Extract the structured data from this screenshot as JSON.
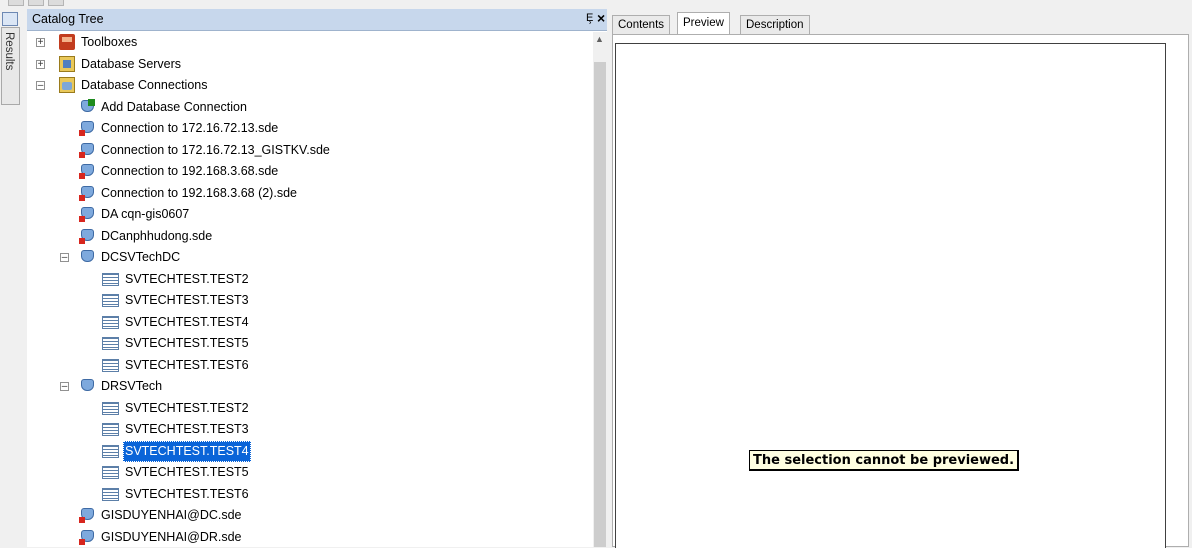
{
  "results_tab": "Results",
  "catalog": {
    "title": "Catalog Tree",
    "pin_glyph": "Ȩ",
    "close_glyph": "×",
    "items": [
      {
        "label": "Toolboxes",
        "indent": 0,
        "expander": "+",
        "icon": "toolbox-icon"
      },
      {
        "label": "Database Servers",
        "indent": 0,
        "expander": "+",
        "icon": "database-servers-icon"
      },
      {
        "label": "Database Connections",
        "indent": 0,
        "expander": "−",
        "icon": "database-connections-icon"
      },
      {
        "label": "Add Database Connection",
        "indent": 1,
        "icon": "add-connection-icon"
      },
      {
        "label": "Connection to 172.16.72.13.sde",
        "indent": 1,
        "icon": "sde-disconnected-icon"
      },
      {
        "label": "Connection to 172.16.72.13_GISTKV.sde",
        "indent": 1,
        "icon": "sde-disconnected-icon"
      },
      {
        "label": "Connection to 192.168.3.68.sde",
        "indent": 1,
        "icon": "sde-disconnected-icon"
      },
      {
        "label": "Connection to 192.168.3.68 (2).sde",
        "indent": 1,
        "icon": "sde-disconnected-icon"
      },
      {
        "label": "DA cqn-gis0607",
        "indent": 1,
        "icon": "sde-disconnected-icon"
      },
      {
        "label": "DCanphhudong.sde",
        "indent": 1,
        "icon": "sde-disconnected-icon"
      },
      {
        "label": "DCSVTechDC",
        "indent": 1,
        "expander": "−",
        "icon": "sde-connected-icon"
      },
      {
        "label": "SVTECHTEST.TEST2",
        "indent": 2,
        "icon": "table-icon"
      },
      {
        "label": "SVTECHTEST.TEST3",
        "indent": 2,
        "icon": "table-icon"
      },
      {
        "label": "SVTECHTEST.TEST4",
        "indent": 2,
        "icon": "table-icon"
      },
      {
        "label": "SVTECHTEST.TEST5",
        "indent": 2,
        "icon": "table-icon"
      },
      {
        "label": "SVTECHTEST.TEST6",
        "indent": 2,
        "icon": "table-icon"
      },
      {
        "label": "DRSVTech",
        "indent": 1,
        "expander": "−",
        "icon": "sde-connected-icon"
      },
      {
        "label": "SVTECHTEST.TEST2",
        "indent": 2,
        "icon": "table-icon"
      },
      {
        "label": "SVTECHTEST.TEST3",
        "indent": 2,
        "icon": "table-icon"
      },
      {
        "label": "SVTECHTEST.TEST4",
        "indent": 2,
        "icon": "table-icon",
        "selected": true
      },
      {
        "label": "SVTECHTEST.TEST5",
        "indent": 2,
        "icon": "table-icon"
      },
      {
        "label": "SVTECHTEST.TEST6",
        "indent": 2,
        "icon": "table-icon"
      },
      {
        "label": "GISDUYENHAI@DC.sde",
        "indent": 1,
        "icon": "sde-disconnected-icon"
      },
      {
        "label": "GISDUYENHAI@DR.sde",
        "indent": 1,
        "icon": "sde-disconnected-icon"
      }
    ]
  },
  "preview": {
    "tabs": [
      {
        "label": "Contents",
        "active": false
      },
      {
        "label": "Preview",
        "active": true
      },
      {
        "label": "Description",
        "active": false
      }
    ],
    "message": "The selection cannot be previewed."
  },
  "colors": {
    "selection": "#0a64d8",
    "title_bar": "#c7d7ec",
    "message_bg": "#ffffe1"
  }
}
